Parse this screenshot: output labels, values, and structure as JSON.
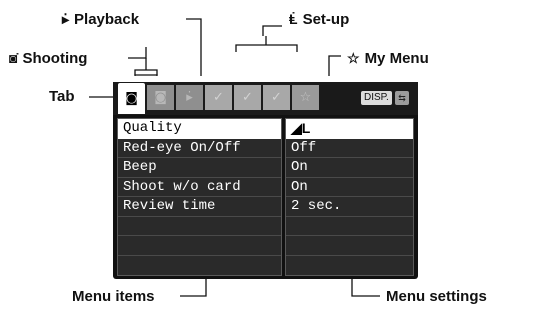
{
  "callouts": {
    "playback": "Playback",
    "setup": "Set-up",
    "shooting": "Shooting",
    "my_menu": "My Menu",
    "tab": "Tab",
    "menu_items": "Menu items",
    "menu_settings": "Menu settings"
  },
  "icons": {
    "playback": "▸̇",
    "setup": "Ⱡ̇",
    "shooting": "◙̇",
    "my_menu": "☆"
  },
  "screen": {
    "tabs": [
      {
        "name": "shooting-tab-1",
        "glyph": "◙̇",
        "active": true
      },
      {
        "name": "shooting-tab-2",
        "glyph": "◙̇",
        "active": false
      },
      {
        "name": "playback-tab",
        "glyph": "▸̇",
        "active": false
      },
      {
        "name": "setup-tab-1",
        "glyph": "✓",
        "active": false
      },
      {
        "name": "setup-tab-2",
        "glyph": "✓",
        "active": false
      },
      {
        "name": "setup-tab-3",
        "glyph": "✓",
        "active": false
      },
      {
        "name": "my-menu-tab",
        "glyph": "☆",
        "active": false
      }
    ],
    "disp_label": "DISP.",
    "lang_label": "⇆",
    "items": [
      "Quality",
      "Red-eye On/Off",
      "Beep",
      "Shoot w/o card",
      "Review time",
      "",
      "",
      ""
    ],
    "settings": [
      "◢L",
      "Off",
      "On",
      "On",
      "2 sec.",
      "",
      "",
      ""
    ],
    "selected_index": 0
  }
}
